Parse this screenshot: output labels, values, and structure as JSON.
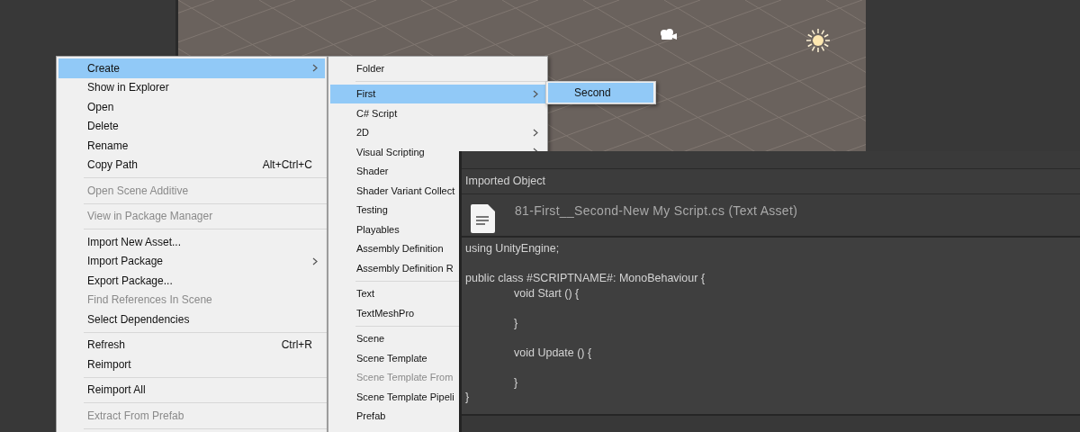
{
  "scene_view": {
    "gizmos": [
      {
        "kind": "camera"
      },
      {
        "kind": "light"
      }
    ]
  },
  "context_menu": {
    "items": [
      {
        "kind": "item",
        "label": "Create",
        "selected": true,
        "disabled": false,
        "has_submenu": true
      },
      {
        "kind": "item",
        "label": "Show in Explorer",
        "selected": false,
        "disabled": false,
        "has_submenu": false
      },
      {
        "kind": "item",
        "label": "Open",
        "selected": false,
        "disabled": false,
        "has_submenu": false
      },
      {
        "kind": "item",
        "label": "Delete",
        "selected": false,
        "disabled": false,
        "has_submenu": false
      },
      {
        "kind": "item",
        "label": "Rename",
        "selected": false,
        "disabled": false,
        "has_submenu": false
      },
      {
        "kind": "item",
        "label": "Copy Path",
        "shortcut": "Alt+Ctrl+C",
        "selected": false,
        "disabled": false,
        "has_submenu": false
      },
      {
        "kind": "separator"
      },
      {
        "kind": "item",
        "label": "Open Scene Additive",
        "selected": false,
        "disabled": true,
        "has_submenu": false
      },
      {
        "kind": "separator"
      },
      {
        "kind": "item",
        "label": "View in Package Manager",
        "selected": false,
        "disabled": true,
        "has_submenu": false
      },
      {
        "kind": "separator"
      },
      {
        "kind": "item",
        "label": "Import New Asset...",
        "selected": false,
        "disabled": false,
        "has_submenu": false
      },
      {
        "kind": "item",
        "label": "Import Package",
        "selected": false,
        "disabled": false,
        "has_submenu": true
      },
      {
        "kind": "item",
        "label": "Export Package...",
        "selected": false,
        "disabled": false,
        "has_submenu": false
      },
      {
        "kind": "item",
        "label": "Find References In Scene",
        "selected": false,
        "disabled": true,
        "has_submenu": false
      },
      {
        "kind": "item",
        "label": "Select Dependencies",
        "selected": false,
        "disabled": false,
        "has_submenu": false
      },
      {
        "kind": "separator"
      },
      {
        "kind": "item",
        "label": "Refresh",
        "shortcut": "Ctrl+R",
        "selected": false,
        "disabled": false,
        "has_submenu": false
      },
      {
        "kind": "item",
        "label": "Reimport",
        "selected": false,
        "disabled": false,
        "has_submenu": false
      },
      {
        "kind": "separator"
      },
      {
        "kind": "item",
        "label": "Reimport All",
        "selected": false,
        "disabled": false,
        "has_submenu": false
      },
      {
        "kind": "separator"
      },
      {
        "kind": "item",
        "label": "Extract From Prefab",
        "selected": false,
        "disabled": true,
        "has_submenu": false
      },
      {
        "kind": "separator"
      }
    ]
  },
  "create_submenu": {
    "items": [
      {
        "kind": "item",
        "label": "Folder",
        "selected": false,
        "disabled": false,
        "has_submenu": false
      },
      {
        "kind": "separator"
      },
      {
        "kind": "item",
        "label": "First",
        "selected": true,
        "disabled": false,
        "has_submenu": true
      },
      {
        "kind": "item",
        "label": "C# Script",
        "selected": false,
        "disabled": false,
        "has_submenu": false
      },
      {
        "kind": "item",
        "label": "2D",
        "selected": false,
        "disabled": false,
        "has_submenu": true
      },
      {
        "kind": "item",
        "label": "Visual Scripting",
        "selected": false,
        "disabled": false,
        "has_submenu": true
      },
      {
        "kind": "item",
        "label": "Shader",
        "selected": false,
        "disabled": false,
        "has_submenu": false
      },
      {
        "kind": "item",
        "label": "Shader Variant Collect",
        "selected": false,
        "disabled": false,
        "has_submenu": false
      },
      {
        "kind": "item",
        "label": "Testing",
        "selected": false,
        "disabled": false,
        "has_submenu": false
      },
      {
        "kind": "item",
        "label": "Playables",
        "selected": false,
        "disabled": false,
        "has_submenu": false
      },
      {
        "kind": "item",
        "label": "Assembly Definition",
        "selected": false,
        "disabled": false,
        "has_submenu": false
      },
      {
        "kind": "item",
        "label": "Assembly Definition R",
        "selected": false,
        "disabled": false,
        "has_submenu": false
      },
      {
        "kind": "separator"
      },
      {
        "kind": "item",
        "label": "Text",
        "selected": false,
        "disabled": false,
        "has_submenu": false
      },
      {
        "kind": "item",
        "label": "TextMeshPro",
        "selected": false,
        "disabled": false,
        "has_submenu": false
      },
      {
        "kind": "separator"
      },
      {
        "kind": "item",
        "label": "Scene",
        "selected": false,
        "disabled": false,
        "has_submenu": false
      },
      {
        "kind": "item",
        "label": "Scene Template",
        "selected": false,
        "disabled": false,
        "has_submenu": false
      },
      {
        "kind": "item",
        "label": "Scene Template From",
        "selected": false,
        "disabled": true,
        "has_submenu": false
      },
      {
        "kind": "item",
        "label": "Scene Template Pipeli",
        "selected": false,
        "disabled": false,
        "has_submenu": false
      },
      {
        "kind": "item",
        "label": "Prefab",
        "selected": false,
        "disabled": false,
        "has_submenu": false
      }
    ]
  },
  "first_submenu": {
    "items": [
      {
        "kind": "item",
        "label": "Second",
        "selected": true,
        "disabled": false,
        "has_submenu": false
      }
    ]
  },
  "inspector": {
    "header": "Imported Object",
    "asset_title": "81-First__Second-New My Script.cs (Text Asset)",
    "code_blocks": [
      [
        {
          "text": "using UnityEngine;",
          "indented": false
        }
      ],
      [
        {
          "text": "public class #SCRIPTNAME#: MonoBehaviour {",
          "indented": false
        },
        {
          "text": "void Start () {",
          "indented": true
        }
      ],
      [
        {
          "text": "}",
          "indented": true
        }
      ],
      [
        {
          "text": "void Update () {",
          "indented": true
        }
      ],
      [
        {
          "text": "}",
          "indented": true
        },
        {
          "text": "}",
          "indented": false
        }
      ]
    ]
  }
}
